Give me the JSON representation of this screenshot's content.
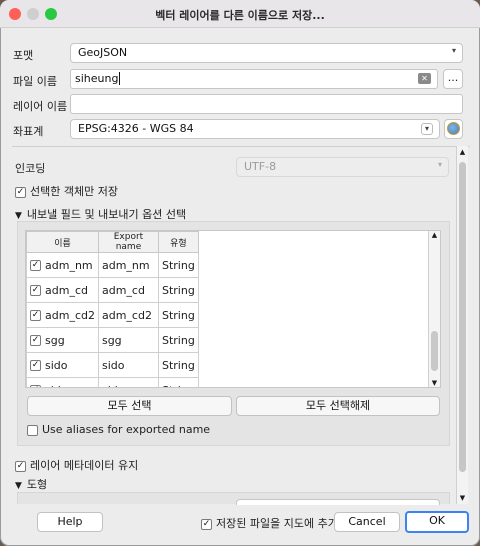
{
  "window": {
    "title": "벡터 레이어를 다른 이름으로 저장..."
  },
  "form": {
    "format_label": "포맷",
    "format_value": "GeoJSON",
    "filename_label": "파일 이름",
    "filename_value": "siheung",
    "browse_label": "...",
    "layername_label": "레이어 이름",
    "layername_value": "",
    "crs_label": "좌표계",
    "crs_value": "EPSG:4326 - WGS 84"
  },
  "encoding": {
    "label": "인코딩",
    "value": "UTF-8"
  },
  "selected_only": {
    "label": "선택한 객체만 저장",
    "checked": true
  },
  "fields_section": {
    "title": "내보낼 필드 및 내보내기 옵션 선택",
    "columns": [
      "이름",
      "Export name",
      "유형"
    ],
    "rows": [
      {
        "name": "adm_nm",
        "export": "adm_nm",
        "type": "String"
      },
      {
        "name": "adm_cd",
        "export": "adm_cd",
        "type": "String"
      },
      {
        "name": "adm_cd2",
        "export": "adm_cd2",
        "type": "String"
      },
      {
        "name": "sgg",
        "export": "sgg",
        "type": "String"
      },
      {
        "name": "sido",
        "export": "sido",
        "type": "String"
      },
      {
        "name": "sidonm",
        "export": "sidonm",
        "type": "String"
      }
    ],
    "select_all": "모두 선택",
    "deselect_all": "모두 선택해제",
    "use_aliases": "Use aliases for exported name"
  },
  "keep_metadata": {
    "label": "레이어 메타데이터 유지",
    "checked": true
  },
  "geometry_section": {
    "title": "도형"
  },
  "footer": {
    "help": "Help",
    "add_to_map": "저장된 파일을 지도에 추가",
    "cancel": "Cancel",
    "ok": "OK"
  },
  "colors": {
    "close": "#ff5f57",
    "minimize": "#febc2e",
    "zoom": "#28c840",
    "accent": "#3b82f6"
  }
}
